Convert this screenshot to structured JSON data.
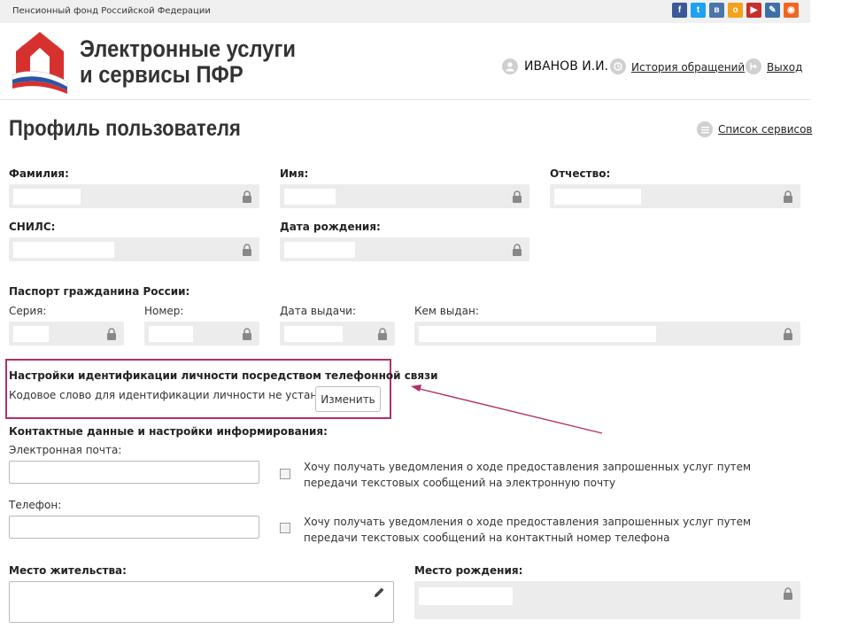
{
  "topbar": {
    "org_name": "Пенсионный фонд Российской Федерации"
  },
  "social": [
    {
      "icon": "facebook-icon",
      "glyph": "f",
      "color": "#3b5998"
    },
    {
      "icon": "twitter-icon",
      "glyph": "t",
      "color": "#1da1f2"
    },
    {
      "icon": "vk-icon",
      "glyph": "в",
      "color": "#4a76a8"
    },
    {
      "icon": "odnoklassniki-icon",
      "glyph": "о",
      "color": "#f4a21b"
    },
    {
      "icon": "youtube-icon",
      "glyph": "▶",
      "color": "#c4302b"
    },
    {
      "icon": "livejournal-icon",
      "glyph": "✎",
      "color": "#3f6fa8"
    },
    {
      "icon": "rss-icon",
      "glyph": "◉",
      "color": "#f26522"
    }
  ],
  "header": {
    "brand_line1": "Электронные услуги",
    "brand_line2": "и сервисы ПФР",
    "username": "ИВАНОВ И.И.",
    "history_link": "История обращений",
    "logout_link": "Выход"
  },
  "page": {
    "title": "Профиль пользователя",
    "services_link": "Список сервисов"
  },
  "fields": {
    "surname": "Фамилия:",
    "name": "Имя:",
    "patronymic": "Отчество:",
    "snils": "СНИЛС:",
    "birth_date": "Дата рождения:"
  },
  "passport": {
    "title": "Паспорт гражданина России:",
    "series": "Серия:",
    "number": "Номер:",
    "issue_date": "Дата выдачи:",
    "issued_by": "Кем выдан:"
  },
  "identification": {
    "title": "Настройки идентификации личности посредством телефонной связи",
    "status": "Кодовое слово для идентификации личности не установлено.",
    "change_button": "Изменить"
  },
  "contacts": {
    "title": "Контактные данные и настройки информирования:",
    "email_label": "Электронная почта:",
    "email_consent": "Хочу получать уведомления о ходе предоставления запрошенных услуг путем передачи текстовых сообщений на электронную почту",
    "phone_label": "Телефон:",
    "phone_consent": "Хочу получать уведомления о ходе предоставления запрошенных услуг путем передачи текстовых сообщений на контактный номер телефона"
  },
  "address": {
    "residence": "Место жительства:",
    "birthplace": "Место рождения:"
  },
  "colors": {
    "highlight": "#b0306a",
    "field_bg": "#ececec"
  }
}
